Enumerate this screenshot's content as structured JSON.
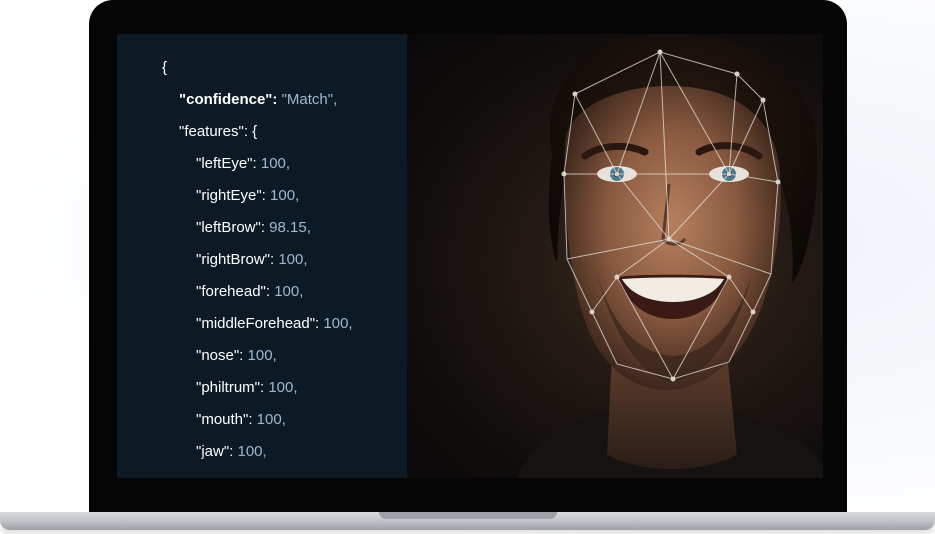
{
  "json_display": {
    "lines": [
      {
        "indent": 0,
        "key": "{",
        "value": "",
        "bold": false
      },
      {
        "indent": 1,
        "key": "\"confidence\":",
        "value": "\"Match\",",
        "bold": true
      },
      {
        "indent": 1,
        "key": "\"features\": {",
        "value": "",
        "bold": false
      },
      {
        "indent": 2,
        "key": "\"leftEye\":",
        "value": "100,",
        "bold": false
      },
      {
        "indent": 2,
        "key": "\"rightEye\":",
        "value": "100,",
        "bold": false
      },
      {
        "indent": 2,
        "key": "\"leftBrow\":",
        "value": "98.15,",
        "bold": false
      },
      {
        "indent": 2,
        "key": "\"rightBrow\":",
        "value": "100,",
        "bold": false
      },
      {
        "indent": 2,
        "key": "\"forehead\":",
        "value": "100,",
        "bold": false
      },
      {
        "indent": 2,
        "key": "\"middleForehead\":",
        "value": "100,",
        "bold": false
      },
      {
        "indent": 2,
        "key": "\"nose\":",
        "value": "100,",
        "bold": false
      },
      {
        "indent": 2,
        "key": "\"philtrum\":",
        "value": "100,",
        "bold": false
      },
      {
        "indent": 2,
        "key": "\"mouth\":",
        "value": "100,",
        "bold": false
      },
      {
        "indent": 2,
        "key": "\"jaw\":",
        "value": "100,",
        "bold": false
      }
    ]
  },
  "photo": {
    "subject": "smiling-man-face-with-mesh-overlay"
  },
  "colors": {
    "code_background": "#0c1a26",
    "code_key": "#ffffff",
    "code_value": "#9fb8cf",
    "mesh_line": "#e8e4dc"
  }
}
